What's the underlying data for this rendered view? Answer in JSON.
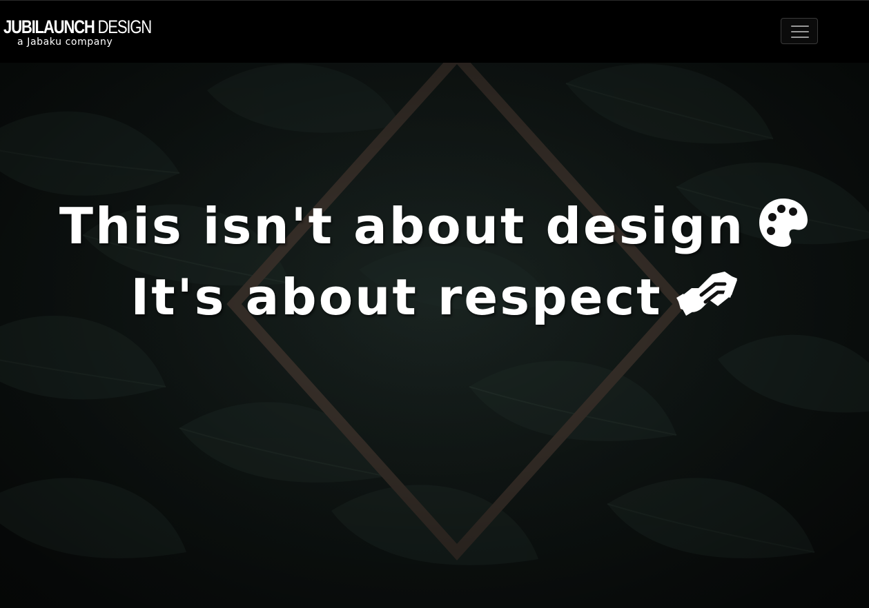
{
  "navbar": {
    "brand_bold": "JUBILAUNCH",
    "brand_light": "DESIGN",
    "brand_tagline": "a Jabaku company",
    "toggle_icon": "hamburger-menu-icon"
  },
  "hero": {
    "line1": "This isn't about design",
    "line1_icon": "artist-palette-icon",
    "line2": "It's about respect",
    "line2_icon": "handshake-icon",
    "background": "dark-leaves-with-diamond-frame",
    "frame_color": "#4a3f36"
  }
}
